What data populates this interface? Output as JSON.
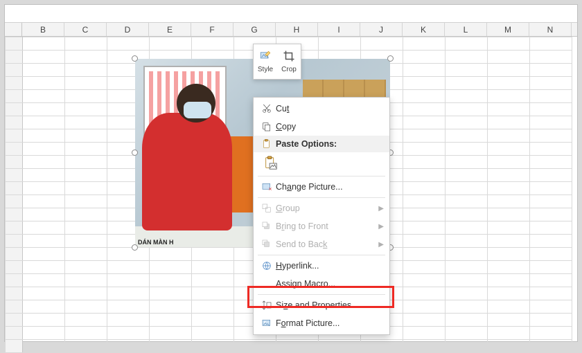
{
  "columns": [
    "B",
    "C",
    "D",
    "E",
    "F",
    "G",
    "H",
    "I",
    "J",
    "K",
    "L",
    "M",
    "N"
  ],
  "minitoolbar": {
    "style": "Style",
    "crop": "Crop"
  },
  "menu": {
    "cut": "Cut",
    "copy": "Copy",
    "paste_header": "Paste Options:",
    "change_picture": "Change Picture...",
    "group": "Group",
    "bring_front": "Bring to Front",
    "send_back": "Send to Back",
    "hyperlink": "Hyperlink...",
    "assign_macro": "Assign Macro...",
    "size_props": "Size and Properties...",
    "format_picture": "Format Picture..."
  },
  "picture": {
    "bottom_text": "DÁN MÀN H"
  }
}
